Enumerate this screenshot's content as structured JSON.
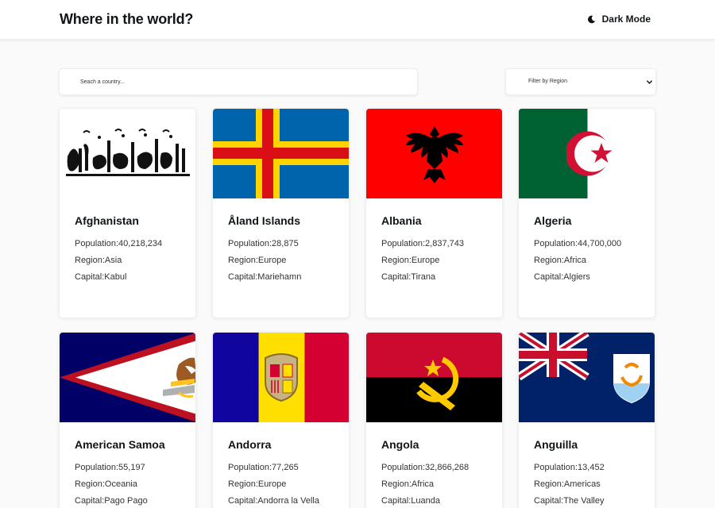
{
  "header": {
    "title": "Where in the world?",
    "dark_mode_label": "Dark Mode"
  },
  "search": {
    "placeholder": "Seach a country..."
  },
  "filter": {
    "label": "Filter by Region"
  },
  "labels": {
    "population": "Population:",
    "region": "Region:",
    "capital": "Capital:"
  },
  "countries": [
    {
      "name": "Afghanistan",
      "population": "40,218,234",
      "region": "Asia",
      "capital": "Kabul",
      "flag_icon": "afghanistan-flag-icon"
    },
    {
      "name": "Åland Islands",
      "population": "28,875",
      "region": "Europe",
      "capital": "Mariehamn",
      "flag_icon": "aland-flag-icon"
    },
    {
      "name": "Albania",
      "population": "2,837,743",
      "region": "Europe",
      "capital": "Tirana",
      "flag_icon": "albania-flag-icon"
    },
    {
      "name": "Algeria",
      "population": "44,700,000",
      "region": "Africa",
      "capital": "Algiers",
      "flag_icon": "algeria-flag-icon"
    },
    {
      "name": "American Samoa",
      "population": "55,197",
      "region": "Oceania",
      "capital": "Pago Pago",
      "flag_icon": "american-samoa-flag-icon"
    },
    {
      "name": "Andorra",
      "population": "77,265",
      "region": "Europe",
      "capital": "Andorra la Vella",
      "flag_icon": "andorra-flag-icon"
    },
    {
      "name": "Angola",
      "population": "32,866,268",
      "region": "Africa",
      "capital": "Luanda",
      "flag_icon": "angola-flag-icon"
    },
    {
      "name": "Anguilla",
      "population": "13,452",
      "region": "Americas",
      "capital": "The Valley",
      "flag_icon": "anguilla-flag-icon"
    }
  ],
  "colors": {
    "background": "#fafafa",
    "surface": "#ffffff",
    "text": "#111517"
  }
}
